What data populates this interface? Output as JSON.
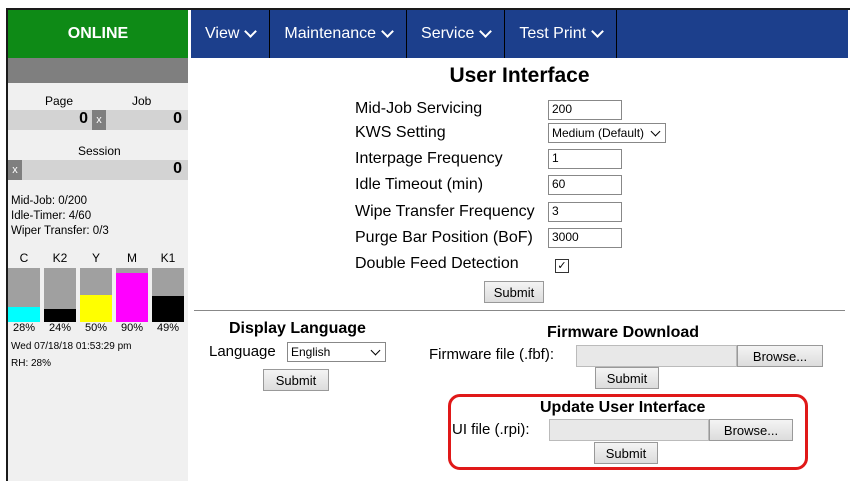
{
  "status": "ONLINE",
  "nav": [
    {
      "label": "View"
    },
    {
      "label": "Maintenance"
    },
    {
      "label": "Service"
    },
    {
      "label": "Test Print"
    }
  ],
  "sidebar": {
    "page_label": "Page",
    "job_label": "Job",
    "page_count": "0",
    "job_count": "0",
    "session_label": "Session",
    "session_count": "0",
    "reset_glyph": "x",
    "mid_job": "Mid-Job: 0/200",
    "idle_timer": "Idle-Timer: 4/60",
    "wiper_transfer": "Wiper Transfer: 0/3",
    "inks": [
      {
        "name": "C",
        "level": 0.28,
        "pct": "28%",
        "color": "#00ffff"
      },
      {
        "name": "K2",
        "level": 0.24,
        "pct": "24%",
        "color": "#000000"
      },
      {
        "name": "Y",
        "level": 0.5,
        "pct": "50%",
        "color": "#ffff00"
      },
      {
        "name": "M",
        "level": 0.9,
        "pct": "90%",
        "color": "#ff00ff"
      },
      {
        "name": "K1",
        "level": 0.49,
        "pct": "49%",
        "color": "#000000"
      }
    ],
    "datetime": "Wed 07/18/18 01:53:29 pm",
    "rh": "RH: 28%"
  },
  "ui_settings": {
    "title": "User Interface",
    "mid_job_label": "Mid-Job Servicing",
    "mid_job_value": "200",
    "kws_label": "KWS Setting",
    "kws_value": "Medium (Default)",
    "interpage_label": "Interpage Frequency",
    "interpage_value": "1",
    "idle_label": "Idle Timeout (min)",
    "idle_value": "60",
    "wipe_label": "Wipe Transfer Frequency",
    "wipe_value": "3",
    "purge_label": "Purge Bar Position (BoF)",
    "purge_value": "3000",
    "double_feed_label": "Double Feed Detection",
    "double_feed_checked": "✓",
    "submit": "Submit"
  },
  "display_language": {
    "title": "Display Language",
    "label": "Language",
    "value": "English",
    "submit": "Submit"
  },
  "firmware": {
    "title": "Firmware Download",
    "label": "Firmware file (.fbf):",
    "browse": "Browse...",
    "submit": "Submit"
  },
  "update_ui": {
    "title": "Update User Interface",
    "label": "UI file (.rpi):",
    "browse": "Browse...",
    "submit": "Submit",
    "highlight_color": "#e01818"
  },
  "colors": {
    "status_green": "#0e8a16",
    "nav_blue": "#1c3f8c"
  }
}
